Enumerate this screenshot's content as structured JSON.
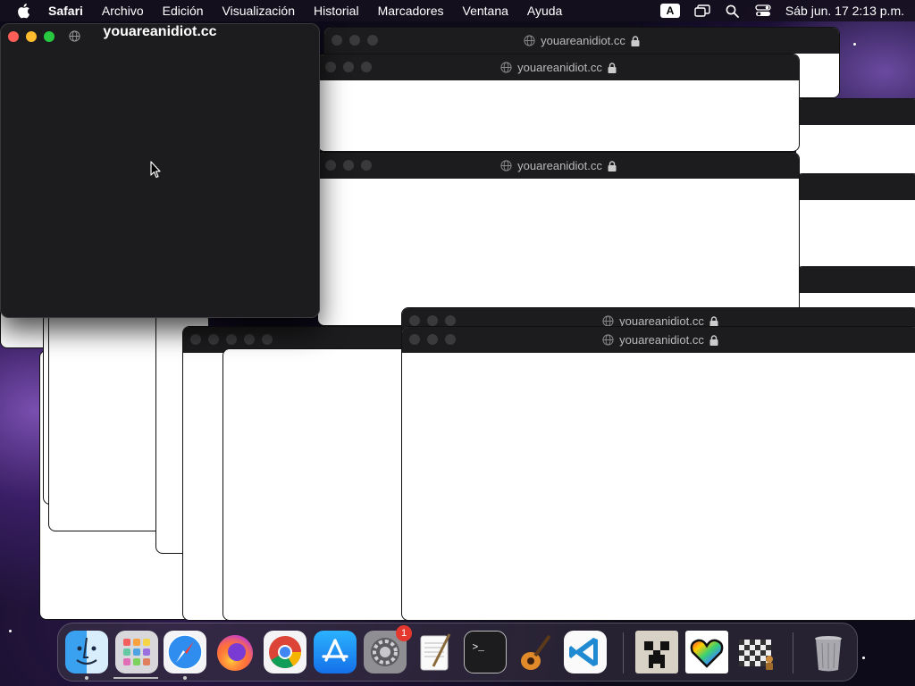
{
  "menubar": {
    "app": "Safari",
    "items": [
      "Archivo",
      "Edición",
      "Visualización",
      "Historial",
      "Marcadores",
      "Ventana",
      "Ayuda"
    ],
    "input_badge": "A",
    "clock": "Sáb jun. 17  2:13 p.m."
  },
  "front_window": {
    "title": "youareanidiot.cc"
  },
  "back_windows": {
    "title": "youareanidiot.cc"
  },
  "dock": {
    "system_preferences_badge": "1",
    "icons": [
      "finder-icon",
      "launchpad-icon",
      "safari-icon",
      "firefox-icon",
      "chrome-icon",
      "app-store-icon",
      "system-preferences-icon",
      "textedit-icon",
      "terminal-icon",
      "garageband-icon",
      "vscode-icon",
      "minecraft-icon",
      "pixel-heart-icon",
      "chess-icon",
      "trash-icon"
    ]
  },
  "colors": {
    "close": "#ff5f57",
    "minimize": "#febc2e",
    "zoom": "#28c840",
    "titlebar": "#1c1c1e",
    "badge": "#e5392f"
  }
}
